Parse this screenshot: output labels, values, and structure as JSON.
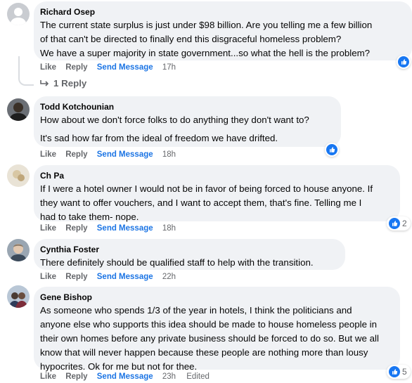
{
  "comments": [
    {
      "author": "Richard Osep",
      "lines": [
        "The current state surplus is just under $98 billion. Are you telling me a few billion",
        "of that can't be directed to finally end this disgraceful homeless problem?",
        "We have a super majority in state government...so what the hell is the problem?"
      ],
      "actions": {
        "like": "Like",
        "reply": "Reply",
        "send": "Send Message",
        "time": "17h"
      },
      "replies_label": "1 Reply"
    },
    {
      "author": "Todd Kotchounian",
      "paragraphs": [
        "How about we don't force folks to do anything they don't want to?",
        "It's sad how far from the ideal of freedom we have drifted."
      ],
      "actions": {
        "like": "Like",
        "reply": "Reply",
        "send": "Send Message",
        "time": "18h"
      }
    },
    {
      "author": "Ch Pa",
      "lines": [
        "If I were a hotel owner I would not be in favor of being forced to house anyone. If",
        "they want to offer vouchers, and I want to accept them, that's fine. Telling me I",
        "had to take them- nope."
      ],
      "actions": {
        "like": "Like",
        "reply": "Reply",
        "send": "Send Message",
        "time": "18h"
      },
      "reaction_count": "2"
    },
    {
      "author": "Cynthia Foster",
      "lines": [
        "There definitely should be qualified staff to help with the transition."
      ],
      "actions": {
        "like": "Like",
        "reply": "Reply",
        "send": "Send Message",
        "time": "22h"
      }
    },
    {
      "author": "Gene Bishop",
      "lines": [
        "As someone who spends 1/3 of the year in hotels, I think the politicians and",
        "anyone else who supports this idea should be made to house homeless people in",
        "their own homes before any private business should be forced to do so. But we all",
        "know that will never happen because these people are nothing more than lousy",
        "hypocrites. Ok for me but not for thee."
      ],
      "actions": {
        "like": "Like",
        "reply": "Reply",
        "send": "Send Message",
        "time": "23h",
        "edited": "Edited"
      },
      "reaction_count": "5"
    }
  ],
  "colors": {
    "bubble": "#f0f2f5",
    "link": "#1b74e4",
    "meta": "#65676b",
    "like": "#1877f2"
  },
  "icons": [
    "like-thumb-icon",
    "reply-arrow-icon"
  ]
}
